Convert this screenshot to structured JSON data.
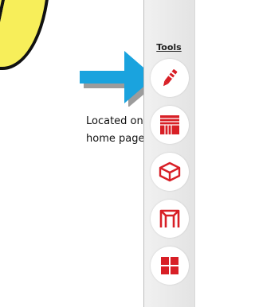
{
  "caption": {
    "line1": "Located on our",
    "line2": "home page."
  },
  "toolbar": {
    "title": "Tools",
    "items": [
      {
        "icon": "pencil-icon"
      },
      {
        "icon": "layers-icon"
      },
      {
        "icon": "box-icon"
      },
      {
        "icon": "frame-icon"
      },
      {
        "icon": "grid-icon"
      }
    ]
  },
  "colors": {
    "accent_red": "#d81f26",
    "arrow_blue": "#1aa3de",
    "bubble_yellow": "#f7ee5a"
  }
}
